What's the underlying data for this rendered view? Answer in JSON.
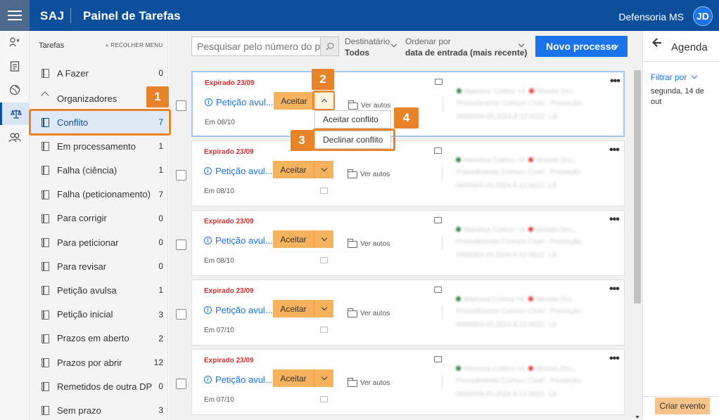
{
  "header": {
    "brand": "SAJ",
    "title": "Painel de Tarefas",
    "org": "Defensoria MS",
    "avatar_initials": "JD"
  },
  "sidebar": {
    "heading": "Tarefas",
    "collapse_label": "« RECOLHER MENU",
    "todo": {
      "label": "A Fazer",
      "count": "0"
    },
    "group_label": "Organizadores",
    "items": [
      {
        "label": "Conflito",
        "count": "7"
      },
      {
        "label": "Em processamento",
        "count": "1"
      },
      {
        "label": "Falha (ciência)",
        "count": "1"
      },
      {
        "label": "Falha (peticionamento)",
        "count": "7"
      },
      {
        "label": "Para corrigir",
        "count": "0"
      },
      {
        "label": "Para peticionar",
        "count": "0"
      },
      {
        "label": "Para revisar",
        "count": "0"
      },
      {
        "label": "Petição avulsa",
        "count": "1"
      },
      {
        "label": "Petição inicial",
        "count": "3"
      },
      {
        "label": "Prazos em aberto",
        "count": "2"
      },
      {
        "label": "Prazos por abrir",
        "count": "12"
      },
      {
        "label": "Remetidos de outra DP",
        "count": "0"
      },
      {
        "label": "Sem prazo",
        "count": "3"
      }
    ]
  },
  "toolbar": {
    "search_placeholder": "Pesquisar pelo número do processo",
    "recipient_label": "Destinatário",
    "recipient_value": "Todos",
    "sort_label": "Ordenar por",
    "sort_value": "data de entrada (mais recente)",
    "new_process": "Novo processo"
  },
  "cards": [
    {
      "expired": "Expirado 23/09",
      "title": "Petição avul...",
      "accept": "Aceitar",
      "date": "Em 08/10",
      "view": "Ver autos"
    },
    {
      "expired": "Expirado 23/09",
      "title": "Petição avul...",
      "accept": "Aceitar",
      "date": "Em 08/10",
      "view": "Ver autos"
    },
    {
      "expired": "Expirado 23/09",
      "title": "Petição avul...",
      "accept": "Aceitar",
      "date": "Em 08/10",
      "view": "Ver autos"
    },
    {
      "expired": "Expirado 23/09",
      "title": "Petição avul...",
      "accept": "Aceitar",
      "date": "Em 07/10",
      "view": "Ver autos"
    },
    {
      "expired": "Expirado 23/09",
      "title": "Petição avul...",
      "accept": "Aceitar",
      "date": "Em 07/10",
      "view": "Ver autos"
    }
  ],
  "blurred": {
    "line1a": "Maresca Coleco +4",
    "line1b": "Mosais Dru...",
    "line2": "Procedimento Comum Cível - Posseção",
    "line3": "0000003-45.2024.8.12.0022",
    "tag": "LB"
  },
  "dropdown": {
    "accept_conflict": "Aceitar conflito",
    "decline_conflict": "Declinar conflito"
  },
  "callouts": [
    "1",
    "2",
    "3",
    "4"
  ],
  "agenda": {
    "title": "Agenda",
    "filter": "Filtrar por",
    "date": "segunda, 14 de out",
    "create": "Criar evento"
  },
  "colors": {
    "primary": "#0e4f9c",
    "accent": "#1a73e8",
    "accept": "#f6b25c",
    "callout": "#e8832a",
    "expired": "#d32f2f"
  }
}
